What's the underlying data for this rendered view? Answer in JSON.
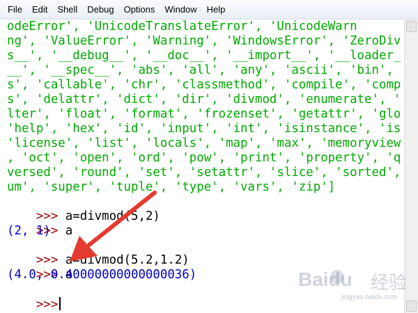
{
  "menu": [
    "File",
    "Edit",
    "Shell",
    "Debug",
    "Options",
    "Window",
    "Help"
  ],
  "builtins_lines": [
    "odeError', 'UnicodeTranslateError', 'UnicodeWarn",
    "ng', 'ValueError', 'Warning', 'WindowsError', 'ZeroDiv",
    "s__', '__debug__', '__doc__', '__import__', '__loader_",
    "__', '__spec__', 'abs', 'all', 'any', 'ascii', 'bin', ",
    "s', 'callable', 'chr', 'classmethod', 'compile', 'comp",
    "s', 'delattr', 'dict', 'dir', 'divmod', 'enumerate', '",
    "lter', 'float', 'format', 'frozenset', 'getattr', 'glo",
    "'help', 'hex', 'id', 'input', 'int', 'isinstance', 'is",
    "'license', 'list', 'locals', 'map', 'max', 'memoryview",
    ", 'oct', 'open', 'ord', 'pow', 'print', 'property', 'q",
    "versed', 'round', 'set', 'setattr', 'slice', 'sorted',",
    "um', 'super', 'tuple', 'type', 'vars', 'zip']"
  ],
  "session": {
    "prompt": ">>>",
    "cmd1": " a=divmod(5,2)",
    "cmd2": " a",
    "out1": "(2, 1)",
    "cmd3": " a=divmod(5.2,1.2)",
    "cmd4": " a",
    "out2": "(4.0, 0.40000000000000036)"
  },
  "watermark": {
    "brand": "Baidu",
    "sub": "经验",
    "url": "jingyan.baidu.com"
  },
  "colors": {
    "string": "#00aa00",
    "prompt": "#990000",
    "output": "#0000cc",
    "arrow": "#e53a2f"
  }
}
